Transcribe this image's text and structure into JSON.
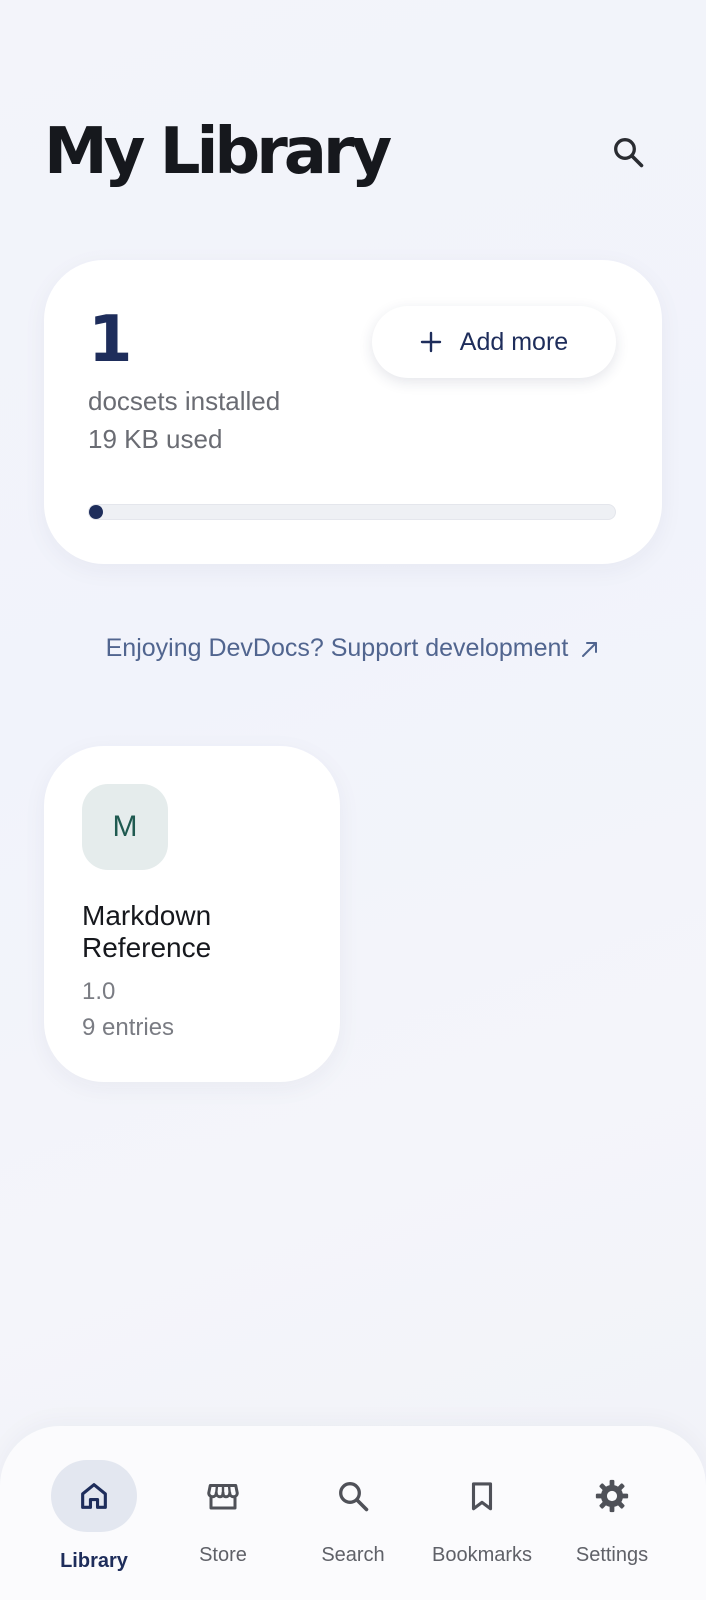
{
  "header": {
    "title": "My Library"
  },
  "stats": {
    "count": "1",
    "label": "docsets installed",
    "size": "19 KB used",
    "progress_fraction": 0.02
  },
  "add_more": {
    "label": "Add more"
  },
  "support": {
    "label": "Enjoying DevDocs? Support development"
  },
  "docsets": [
    {
      "badge": "M",
      "name": "Markdown Reference",
      "version": "1.0",
      "entries": "9 entries"
    }
  ],
  "nav": {
    "items": [
      {
        "label": "Library",
        "icon": "home-icon",
        "active": true
      },
      {
        "label": "Store",
        "icon": "store-icon",
        "active": false
      },
      {
        "label": "Search",
        "icon": "search-icon",
        "active": false
      },
      {
        "label": "Bookmarks",
        "icon": "bookmark-icon",
        "active": false
      },
      {
        "label": "Settings",
        "icon": "gear-icon",
        "active": false
      }
    ]
  },
  "colors": {
    "accent": "#1e2d5b",
    "link": "#51658f",
    "badge_bg": "#e5ecec",
    "badge_text": "#1f5a50"
  }
}
